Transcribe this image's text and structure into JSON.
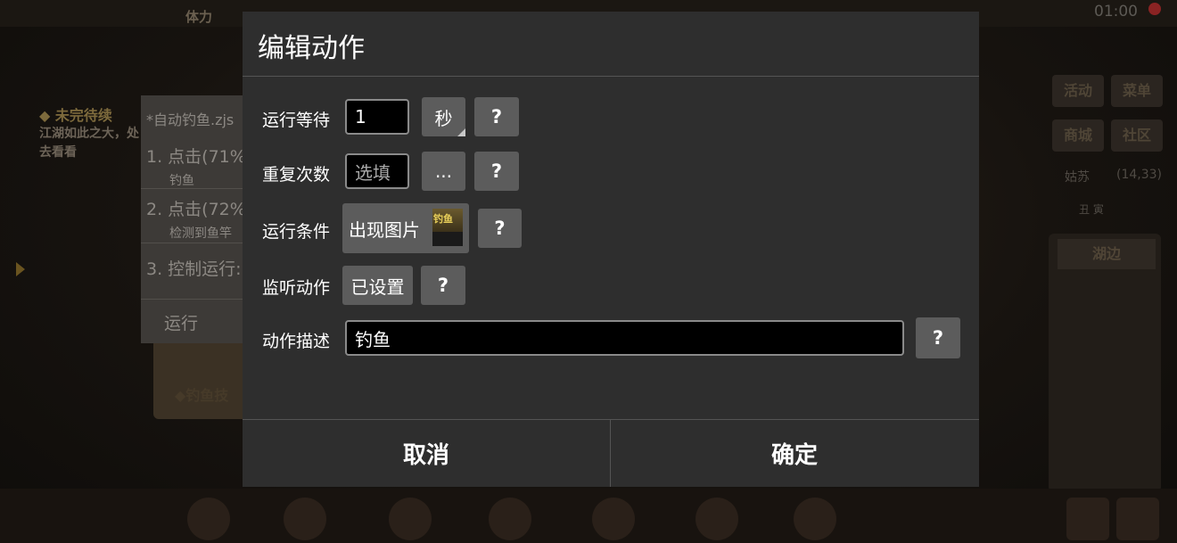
{
  "background": {
    "stat_label": "体力",
    "clock": "01:00",
    "quest_title": "◆ 未完待续",
    "quest_desc": "江湖如此之大，处去看看",
    "scroll_label": "◆钓鱼技",
    "right_buttons": [
      "活动",
      "菜单",
      "商城",
      "社区"
    ],
    "location": "姑苏",
    "coords": "(14,33)",
    "time_of_day": "丑  寅",
    "lake_label": "湖边"
  },
  "script_panel": {
    "filename": "*自动钓鱼.zjs",
    "steps": [
      {
        "label": "1. 点击(71%,",
        "sub": "钓鱼"
      },
      {
        "label": "2. 点击(72%",
        "sub": "检测到鱼竿"
      },
      {
        "label": "3. 控制运行:",
        "sub": ""
      }
    ],
    "run_label": "运行"
  },
  "dialog": {
    "title": "编辑动作",
    "rows": {
      "wait": {
        "label": "运行等待",
        "value": "1",
        "unit": "秒",
        "help": "?"
      },
      "repeat": {
        "label": "重复次数",
        "placeholder": "选填",
        "more": "...",
        "help": "?"
      },
      "condition": {
        "label": "运行条件",
        "value": "出现图片",
        "thumb_text": "钓鱼",
        "help": "?"
      },
      "listen": {
        "label": "监听动作",
        "value": "已设置",
        "help": "?"
      },
      "desc": {
        "label": "动作描述",
        "value": "钓鱼",
        "help": "?"
      }
    },
    "cancel": "取消",
    "confirm": "确定"
  }
}
